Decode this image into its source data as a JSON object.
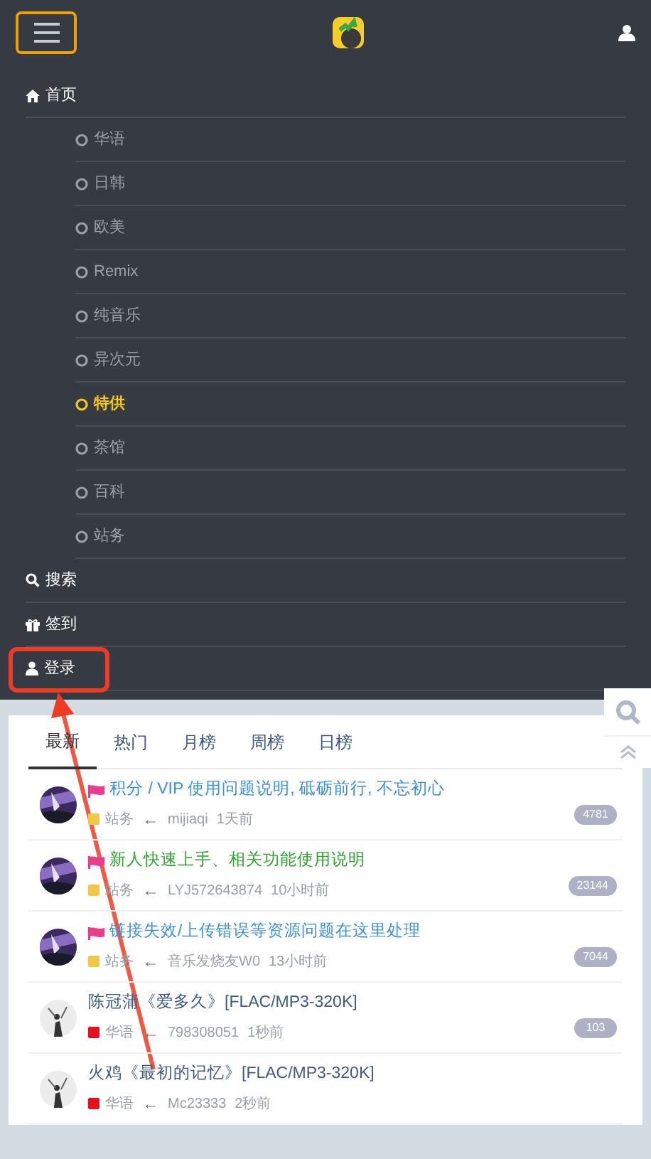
{
  "menu": {
    "items": [
      {
        "label": "首页",
        "highlighted": false,
        "children": [
          {
            "label": "华语",
            "selected": false
          },
          {
            "label": "日韩",
            "selected": false
          },
          {
            "label": "欧美",
            "selected": false
          },
          {
            "label": "Remix",
            "selected": false
          },
          {
            "label": "纯音乐",
            "selected": false
          },
          {
            "label": "异次元",
            "selected": false
          },
          {
            "label": "特供",
            "selected": true
          },
          {
            "label": "茶馆",
            "selected": false
          },
          {
            "label": "百科",
            "selected": false
          },
          {
            "label": "站务",
            "selected": false
          }
        ]
      },
      {
        "label": "搜索",
        "highlighted": false
      },
      {
        "label": "签到",
        "highlighted": false
      },
      {
        "label": "登录",
        "highlighted": true
      }
    ]
  },
  "tabs": [
    {
      "label": "最新",
      "selected": true
    },
    {
      "label": "热门",
      "selected": false
    },
    {
      "label": "月榜",
      "selected": false
    },
    {
      "label": "周榜",
      "selected": false
    },
    {
      "label": "日榜",
      "selected": false
    }
  ],
  "threads": [
    {
      "pinned": true,
      "title": "积分 / VIP 使用问题说明, 砥砺前行, 不忘初心",
      "category": "站务",
      "color": "#f2c744",
      "arrow": "←",
      "user": "mijiaqi",
      "time": "1天前",
      "count": "4781"
    },
    {
      "pinned": true,
      "title": "新人快速上手、相关功能使用说明",
      "category": "站务",
      "color": "#f2c744",
      "arrow": "←",
      "user": "LYJ572643874",
      "time": "10小时前",
      "count": "23144"
    },
    {
      "pinned": true,
      "title": "链接失效/上传错误等资源问题在这里处理",
      "category": "站务",
      "color": "#f2c744",
      "arrow": "←",
      "user": "音乐发烧友W0",
      "time": "13小时前",
      "count": "7044"
    },
    {
      "pinned": false,
      "title": "陈冠蒲《爱多久》[FLAC/MP3-320K]",
      "category": "华语",
      "color": "#e8101c",
      "arrow": "←",
      "user": "798308051",
      "time": "1秒前",
      "count": "103"
    },
    {
      "pinned": false,
      "title": "火鸡《最初的记忆》[FLAC/MP3-320K]",
      "category": "华语",
      "color": "#e8101c",
      "arrow": "←",
      "user": "Mc23333",
      "time": "2秒前"
    }
  ]
}
